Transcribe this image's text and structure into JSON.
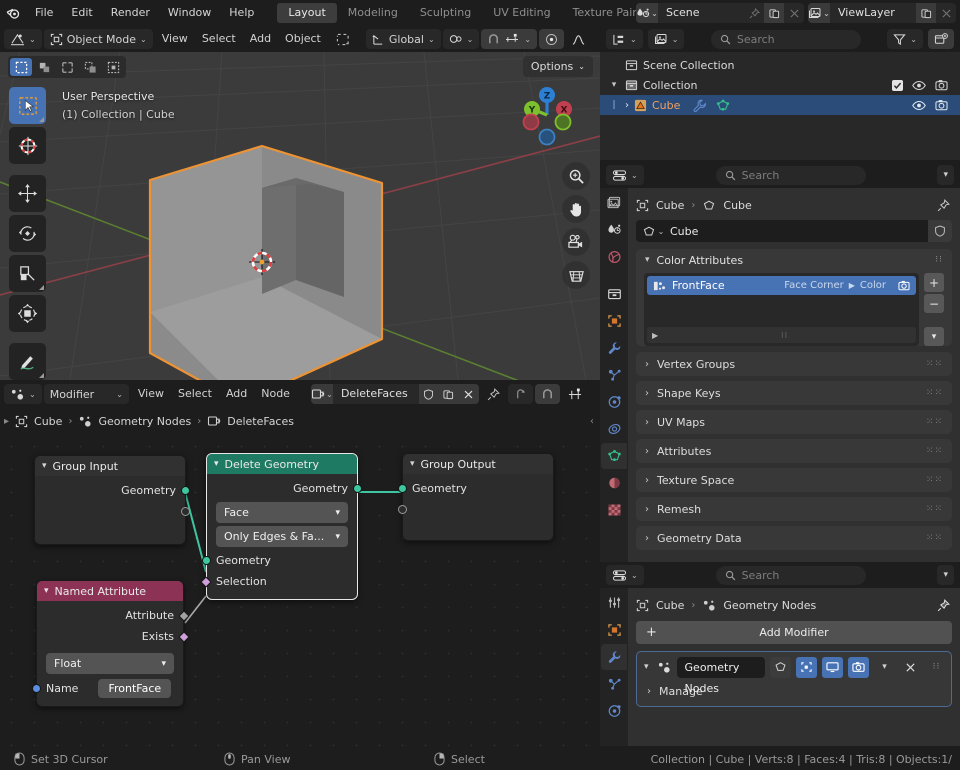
{
  "topbar": {
    "menus": [
      "File",
      "Edit",
      "Render",
      "Window",
      "Help"
    ],
    "workspaces": [
      {
        "label": "Layout",
        "active": true
      },
      {
        "label": "Modeling",
        "active": false
      },
      {
        "label": "Sculpting",
        "active": false
      },
      {
        "label": "UV Editing",
        "active": false
      },
      {
        "label": "Texture Paint",
        "active": false
      }
    ],
    "scene_name": "Scene",
    "viewlayer_name": "ViewLayer"
  },
  "viewport": {
    "header": {
      "mode": "Object Mode",
      "menus": [
        "View",
        "Select",
        "Add",
        "Object"
      ],
      "transform_orientation": "Global"
    },
    "options_label": "Options",
    "overlay_line1": "User Perspective",
    "overlay_line2": "(1) Collection | Cube",
    "gizmo_axes": [
      {
        "label": "Z",
        "color": "#2b7fd4"
      },
      {
        "label": "Y",
        "color": "#7dbf2c"
      },
      {
        "label": "X",
        "color": "#c0404f"
      }
    ],
    "object_outline_color": "#ed9334"
  },
  "outliner": {
    "search_placeholder": "Search",
    "rows": [
      {
        "label": "Scene Collection",
        "indent": 0,
        "icon": "collection-icon",
        "selected": false
      },
      {
        "label": "Collection",
        "indent": 1,
        "icon": "collection-icon",
        "selected": false
      },
      {
        "label": "Cube",
        "indent": 2,
        "icon": "mesh-object-icon",
        "selected": true
      }
    ]
  },
  "node_editor": {
    "header": {
      "context": "Modifier",
      "menus": [
        "View",
        "Select",
        "Add",
        "Node"
      ],
      "node_group_name": "DeleteFaces"
    },
    "breadcrumb": [
      "Cube",
      "Geometry Nodes",
      "DeleteFaces"
    ],
    "nodes": [
      {
        "id": "group-input",
        "title": "Group Input",
        "header_color": "#313131",
        "outputs": [
          "Geometry"
        ],
        "selected": false
      },
      {
        "id": "delete-geometry",
        "title": "Delete Geometry",
        "header_color": "#1f7a63",
        "outputs": [
          "Geometry"
        ],
        "dropdowns": [
          "Face",
          "Only Edges & Fa..."
        ],
        "inputs": [
          "Geometry",
          "Selection"
        ],
        "selected": true
      },
      {
        "id": "group-output",
        "title": "Group Output",
        "header_color": "#313131",
        "inputs": [
          "Geometry"
        ],
        "selected": false
      },
      {
        "id": "named-attribute",
        "title": "Named Attribute",
        "header_color": "#8c3355",
        "outputs": [
          "Attribute",
          "Exists"
        ],
        "dropdowns": [
          "Float"
        ],
        "field_label": "Name",
        "field_value": "FrontFace",
        "selected": false
      }
    ]
  },
  "properties_data": {
    "search_placeholder": "Search",
    "breadcrumb": [
      "Cube",
      "Cube"
    ],
    "datablock_name": "Cube",
    "color_attributes": {
      "title": "Color Attributes",
      "items": [
        {
          "name": "FrontFace",
          "domain": "Face Corner",
          "type": "Color",
          "selected": true
        }
      ]
    },
    "panels": [
      "Vertex Groups",
      "Shape Keys",
      "UV Maps",
      "Attributes",
      "Texture Space",
      "Remesh",
      "Geometry Data"
    ]
  },
  "properties_modifier": {
    "search_placeholder": "Search",
    "breadcrumb": [
      "Cube",
      "Geometry Nodes"
    ],
    "add_modifier_label": "Add Modifier",
    "modifier": {
      "name": "Geometry Nodes",
      "sub_panel": "Manage",
      "toggles": [
        {
          "name": "edit-mode-display-toggle",
          "on": false
        },
        {
          "name": "realtime-display-toggle",
          "on": true
        },
        {
          "name": "viewport-display-toggle",
          "on": true
        },
        {
          "name": "render-display-toggle",
          "on": true
        }
      ]
    }
  },
  "statusbar": {
    "hints": [
      {
        "label": "Set 3D Cursor",
        "icon": "mouse-left-icon"
      },
      {
        "label": "Pan View",
        "icon": "mouse-middle-icon"
      },
      {
        "label": "Select",
        "icon": "mouse-right-icon"
      }
    ],
    "stats": "Collection | Cube | Verts:8 | Faces:4 | Tris:8 | Objects:1/"
  }
}
